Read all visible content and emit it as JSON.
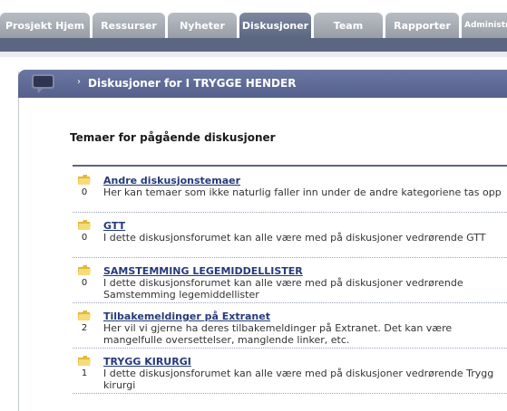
{
  "tabs": [
    {
      "label": "Prosjekt Hjem",
      "active": false
    },
    {
      "label": "Ressurser",
      "active": false
    },
    {
      "label": "Nyheter",
      "active": false
    },
    {
      "label": "Diskusjoner",
      "active": true
    },
    {
      "label": "Team",
      "active": false
    },
    {
      "label": "Rapporter",
      "active": false
    },
    {
      "label": "Administra",
      "active": false
    }
  ],
  "panel": {
    "title": "Diskusjoner for I TRYGGE HENDER",
    "section_title": "Temaer for pågående diskusjoner"
  },
  "topics": [
    {
      "title": "Andre diskusjonstemaer",
      "description": "Her kan temaer som ikke naturlig faller inn under de andre kategoriene tas opp",
      "count": "0"
    },
    {
      "title": "GTT",
      "description": "I dette diskusjonsforumet kan alle være med på diskusjoner vedrørende GTT",
      "count": "0"
    },
    {
      "title": "SAMSTEMMING LEGEMIDDELLISTER",
      "description": "I dette diskusjonsforumet kan alle være med på diskusjoner vedrørende Samstemming legemiddellister",
      "count": "0"
    },
    {
      "title": "Tilbakemeldinger på Extranet",
      "description": "Her vil vi gjerne ha deres tilbakemeldinger på Extranet. Det kan være mangelfulle oversettelser, manglende linker, etc.",
      "count": "2"
    },
    {
      "title": "TRYGG KIRURGI",
      "description": "I dette diskusjonsforumet kan alle være med på diskusjoner vedrørende Trygg kirurgi",
      "count": "1"
    }
  ],
  "colors": {
    "nav_band": "#5b6681",
    "header": "#5f6a94",
    "link": "#243a7a",
    "folder": "#f2d04a"
  }
}
